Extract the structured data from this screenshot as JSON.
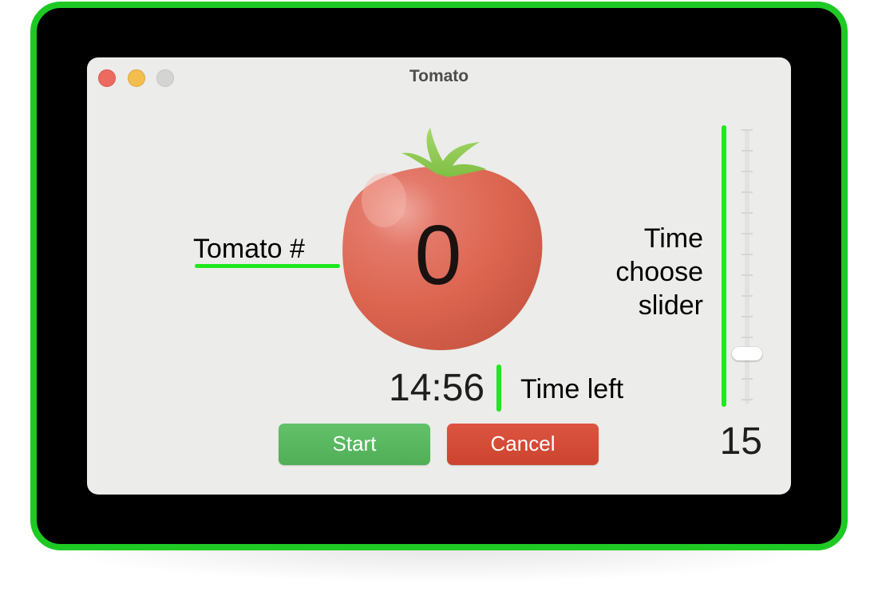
{
  "window": {
    "title": "Tomato"
  },
  "tomato": {
    "count": "0",
    "label": "Tomato #"
  },
  "timer": {
    "time_left": "14:56",
    "label": "Time left"
  },
  "slider": {
    "label_lines": [
      "Time",
      "choose",
      "slider"
    ],
    "value": "15",
    "tick_count": 14,
    "level": 0.17
  },
  "buttons": {
    "start_label": "Start",
    "cancel_label": "Cancel"
  },
  "colors": {
    "annotation_green": "#1ee81e",
    "device_border": "#1ec924",
    "start_button": "#58b85f",
    "cancel_button": "#d44c38",
    "tomato_red": "#e0604a",
    "window_background": "#ececea"
  },
  "icons": {
    "close": "close-traffic-light-icon",
    "minimize": "minimize-traffic-light-icon",
    "zoom": "zoom-traffic-light-icon",
    "tomato": "tomato-icon"
  }
}
